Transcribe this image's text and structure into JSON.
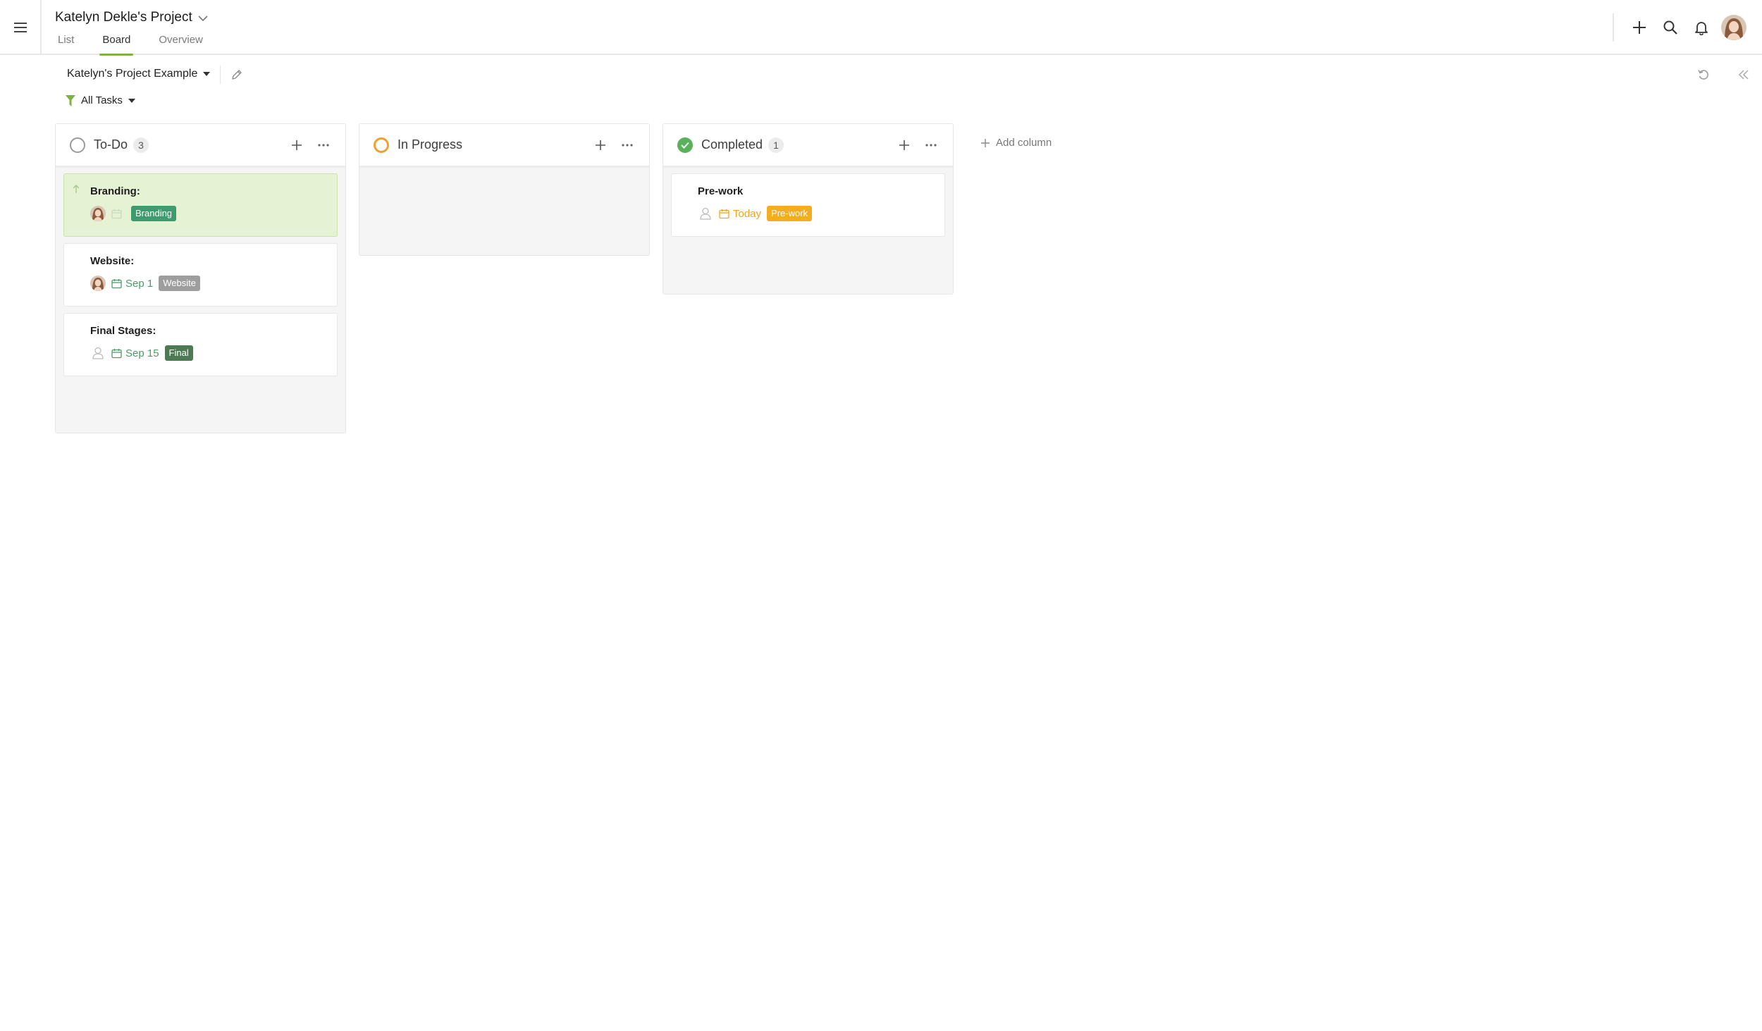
{
  "header": {
    "project_title": "Katelyn Dekle's Project",
    "tabs": [
      {
        "label": "List",
        "active": false
      },
      {
        "label": "Board",
        "active": true
      },
      {
        "label": "Overview",
        "active": false
      }
    ]
  },
  "toolbar": {
    "board_name": "Katelyn's Project Example",
    "filter_label": "All Tasks"
  },
  "columns": [
    {
      "title": "To-Do",
      "count": "3",
      "status": "todo",
      "cards": [
        {
          "title": "Branding:",
          "due": "",
          "tag": "Branding",
          "tag_color": "#3f9a6e",
          "assignee": "avatar",
          "highlight": true,
          "priority": "up"
        },
        {
          "title": "Website:",
          "due": "Sep 1",
          "tag": "Website",
          "tag_color": "#9e9e9e",
          "assignee": "avatar"
        },
        {
          "title": "Final Stages:",
          "due": "Sep 15",
          "tag": "Final",
          "tag_color": "#4c7a55",
          "assignee": "none"
        }
      ]
    },
    {
      "title": "In Progress",
      "count": "",
      "status": "in-progress",
      "cards": []
    },
    {
      "title": "Completed",
      "count": "1",
      "status": "completed",
      "cards": [
        {
          "title": "Pre-work",
          "due": "Today",
          "tag": "Pre-work",
          "tag_color": "#f4ae1c",
          "assignee": "none"
        }
      ]
    }
  ],
  "add_column_label": "Add column",
  "colors": {
    "accent": "#7cb342",
    "todo": "#9a9a9a",
    "in_progress": "#f0a030",
    "completed": "#58b15b",
    "due_text": "#4c9a6a",
    "due_today": "#f2a31b"
  },
  "icons": [
    "hamburger-icon",
    "chevron-down-icon",
    "plus-icon",
    "search-icon",
    "bell-icon",
    "pencil-icon",
    "filter-icon",
    "caret-down-icon",
    "undo-icon",
    "collapse-icon",
    "ellipsis-icon",
    "check-icon",
    "calendar-icon",
    "person-icon",
    "arrow-up-icon"
  ]
}
